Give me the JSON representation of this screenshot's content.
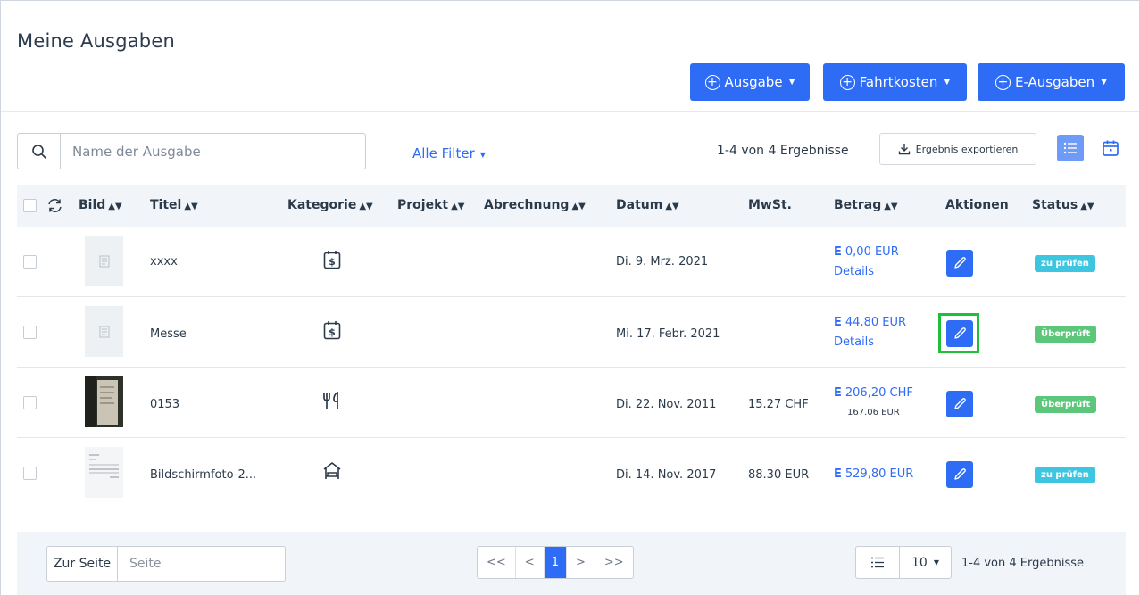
{
  "header": {
    "title": "Meine Ausgaben",
    "buttons": [
      {
        "label": "Ausgabe"
      },
      {
        "label": "Fahrtkosten"
      },
      {
        "label": "E-Ausgaben"
      }
    ]
  },
  "toolbar": {
    "search_placeholder": "Name der Ausgabe",
    "filter_label": "Alle Filter",
    "results": "1-4 von 4 Ergebnisse",
    "export_label": "Ergebnis exportieren"
  },
  "table": {
    "columns": {
      "bild": "Bild",
      "titel": "Titel",
      "kategorie": "Kategorie",
      "projekt": "Projekt",
      "abrechnung": "Abrechnung",
      "datum": "Datum",
      "mwst": "MwSt.",
      "betrag": "Betrag",
      "aktionen": "Aktionen",
      "status": "Status"
    },
    "rows": [
      {
        "title": "xxxx",
        "category_icon": "calendar-dollar-icon",
        "date": "Di. 9. Mrz. 2021",
        "mwst": "",
        "amount_prefix": "E",
        "amount": "0,00 EUR",
        "details": "Details",
        "sub_amount": "",
        "status": "zu prüfen",
        "status_color": "#3ec6e0"
      },
      {
        "title": "Messe",
        "category_icon": "calendar-dollar-icon",
        "date": "Mi. 17. Febr. 2021",
        "mwst": "",
        "amount_prefix": "E",
        "amount": "44,80 EUR",
        "details": "Details",
        "sub_amount": "",
        "status": "Überprüft",
        "status_color": "#5cc77a"
      },
      {
        "title": "0153",
        "category_icon": "fork-knife-icon",
        "date": "Di. 22. Nov. 2011",
        "mwst": "15.27 CHF",
        "amount_prefix": "E",
        "amount": "206,20 CHF",
        "details": "",
        "sub_amount": "167.06 EUR",
        "status": "Überprüft",
        "status_color": "#5cc77a"
      },
      {
        "title": "Bildschirmfoto-2...",
        "category_icon": "hotel-bed-icon",
        "date": "Di. 14. Nov. 2017",
        "mwst": "88.30 EUR",
        "amount_prefix": "E",
        "amount": "529,80 EUR",
        "details": "",
        "sub_amount": "",
        "status": "zu prüfen",
        "status_color": "#3ec6e0"
      }
    ]
  },
  "footer": {
    "goto_label": "Zur Seite",
    "page_placeholder": "Seite",
    "pager": [
      "<<",
      "<",
      "1",
      ">",
      ">>"
    ],
    "page_size": "10",
    "results": "1-4 von 4 Ergebnisse"
  }
}
